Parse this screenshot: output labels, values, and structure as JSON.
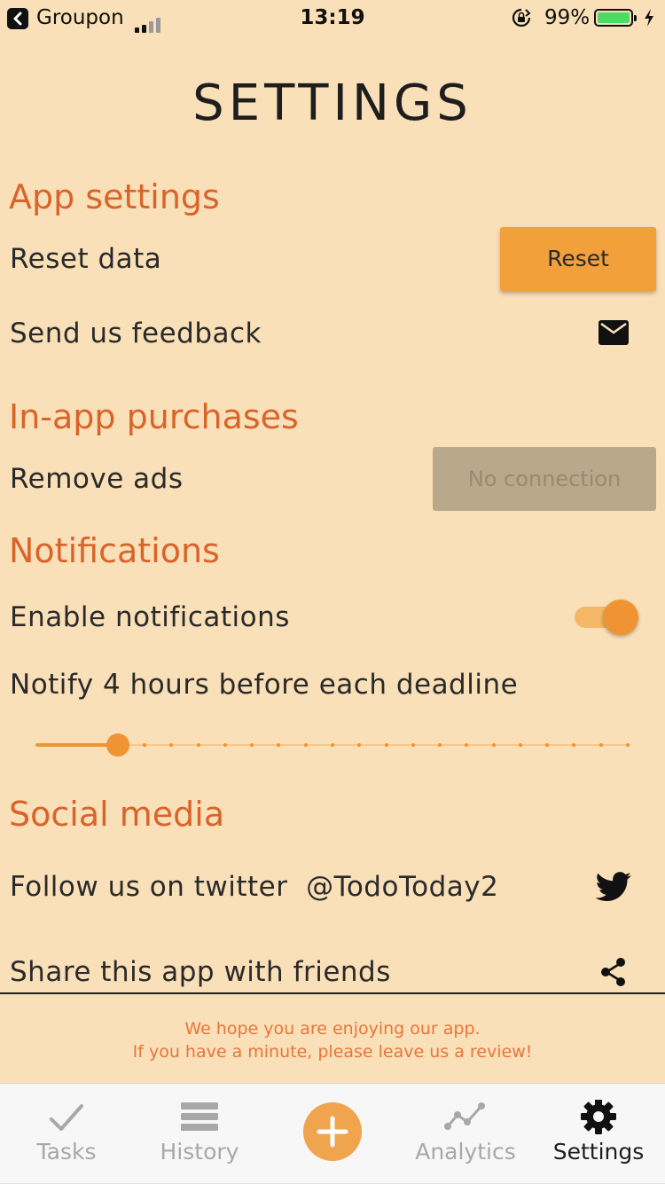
{
  "status_bar": {
    "back_app": "Groupon",
    "time": "13:19",
    "battery_percent": "99%",
    "battery_level": 0.99
  },
  "page": {
    "title": "SETTINGS"
  },
  "sections": {
    "app_settings": {
      "heading": "App settings",
      "reset_label": "Reset data",
      "reset_button": "Reset",
      "feedback_label": "Send us feedback",
      "feedback_icon": "mail-icon"
    },
    "purchases": {
      "heading": "In-app purchases",
      "remove_ads_label": "Remove ads",
      "remove_ads_button": "No connection"
    },
    "notifications": {
      "heading": "Notifications",
      "enable_label": "Enable notifications",
      "enabled": true,
      "notify_label": "Notify 4 hours before each deadline",
      "slider_value": 4,
      "slider_steps": 23
    },
    "social": {
      "heading": "Social media",
      "twitter_label": "Follow us on twitter  @TodoToday2",
      "twitter_icon": "twitter-icon",
      "share_label": "Share this app with friends",
      "share_icon": "share-icon"
    }
  },
  "review": {
    "line1": "We hope you are enjoying our app.",
    "line2": "If you have a minute, please leave us a review!"
  },
  "tab_bar": {
    "tasks": "Tasks",
    "history": "History",
    "add_icon": "plus-icon",
    "analytics": "Analytics",
    "settings": "Settings",
    "active": "settings"
  },
  "colors": {
    "background": "#fae0b8",
    "accent": "#ef9333",
    "heading": "#d9642a",
    "review_text": "#e8753a"
  }
}
